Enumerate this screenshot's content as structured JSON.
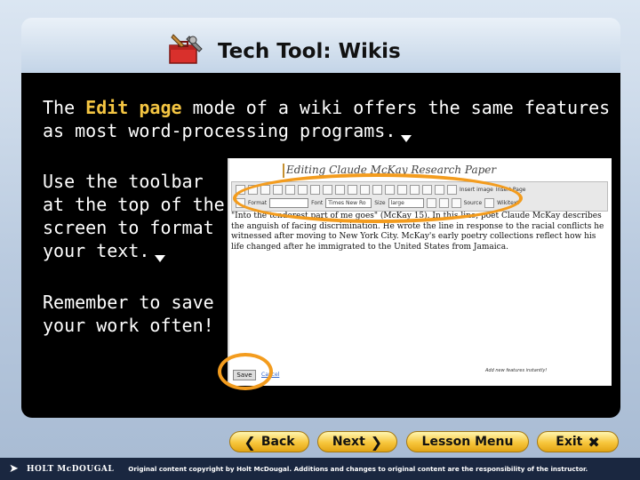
{
  "slide": {
    "title": "Tech Tool: Wikis",
    "intro_before": "The ",
    "intro_highlight": "Edit page",
    "intro_after": " mode of a wiki offers the same features as most word-processing programs.",
    "toolbar_text": "Use the toolbar at the top of the screen to format your text.",
    "save_text": "Remember to save your work often!"
  },
  "wiki": {
    "page_title": "Editing Claude McKay Research Paper",
    "toolbar": {
      "format_label": "Format",
      "font_label": "Font",
      "font_value": "Times New Ro",
      "size_label": "Size",
      "size_value": "large",
      "insert_image": "Insert image",
      "insert_page": "Insert Page",
      "source": "Source",
      "wikitext": "Wikitext"
    },
    "body": "\"Into the tenderest part of me goes\" (McKay 15). In this line, poet Claude McKay describes the anguish of facing discrimination. He wrote the line in response to the racial conflicts he witnessed after moving to New York City. McKay's early poetry collections reflect how his life changed after he immigrated to the United States from Jamaica.",
    "save_button": "Save",
    "cancel_link": "Cancel",
    "footer_note": "Add new features instantly!"
  },
  "nav": {
    "back": "Back",
    "next": "Next",
    "lesson_menu": "Lesson Menu",
    "exit": "Exit"
  },
  "footer": {
    "logo": "HOLT McDOUGAL",
    "copyright": "Original content copyright by Holt McDougal. Additions and changes to original content are the responsibility of the instructor."
  },
  "colors": {
    "highlight": "#f4c542",
    "panel": "#000000",
    "nav_button": "#f7c63c",
    "oval": "#f39c1e",
    "footer_bg": "#1a2740"
  },
  "icons": {
    "title_icon": "toolbox-icon",
    "arrow": "arrow-down-icon"
  }
}
